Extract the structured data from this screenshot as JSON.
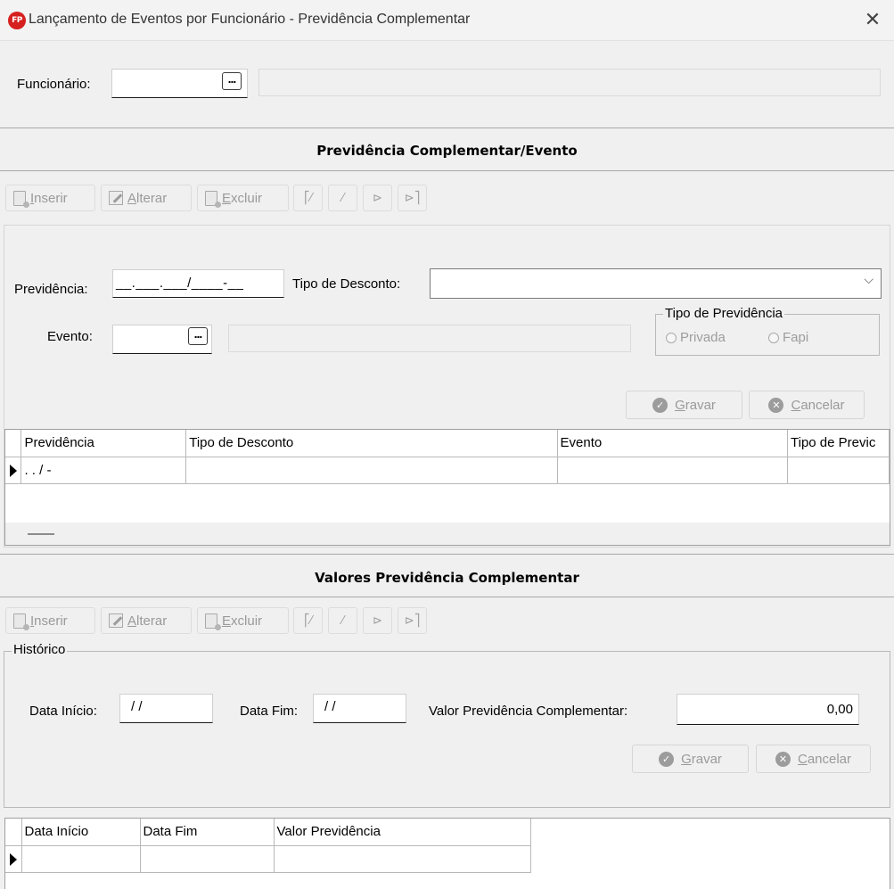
{
  "window": {
    "title": "Lançamento de Eventos por Funcionário - Previdência Complementar",
    "app_icon_text": "FP",
    "close_glyph": "✕"
  },
  "funcionario": {
    "label": "Funcionário:",
    "value": "",
    "lookup": "...",
    "name": ""
  },
  "section1": {
    "title": "Previdência Complementar/Evento",
    "toolbar": {
      "insert": "Inserir",
      "edit": "Alterar",
      "delete": "Excluir"
    },
    "previdencia": {
      "label": "Previdência:",
      "mask": "__.___.___/____-__"
    },
    "tipo_desconto": {
      "label": "Tipo de Desconto:",
      "value": ""
    },
    "evento": {
      "label": "Evento:",
      "value": "",
      "lookup": "...",
      "name": ""
    },
    "tipo_previdencia": {
      "legend": "Tipo de Previdência",
      "options": [
        "Privada",
        "Fapi"
      ]
    },
    "save": "Gravar",
    "cancel": "Cancelar",
    "grid": {
      "columns": [
        "Previdência",
        "Tipo de Desconto",
        "Evento",
        "Tipo de Previc"
      ],
      "row": [
        ". . /  -",
        "",
        "",
        ""
      ]
    }
  },
  "section2": {
    "title": "Valores Previdência Complementar",
    "toolbar": {
      "insert": "Inserir",
      "edit": "Alterar",
      "delete": "Excluir"
    },
    "historico": "Histórico",
    "data_inicio": {
      "label": "Data Início:",
      "value": "/ /"
    },
    "data_fim": {
      "label": "Data Fim:",
      "value": "/ /"
    },
    "valor": {
      "label": "Valor Previdência Complementar:",
      "value": "0,00"
    },
    "save": "Gravar",
    "cancel": "Cancelar",
    "grid": {
      "columns": [
        "Data Início",
        "Data Fim",
        "Valor Previdência"
      ]
    }
  }
}
